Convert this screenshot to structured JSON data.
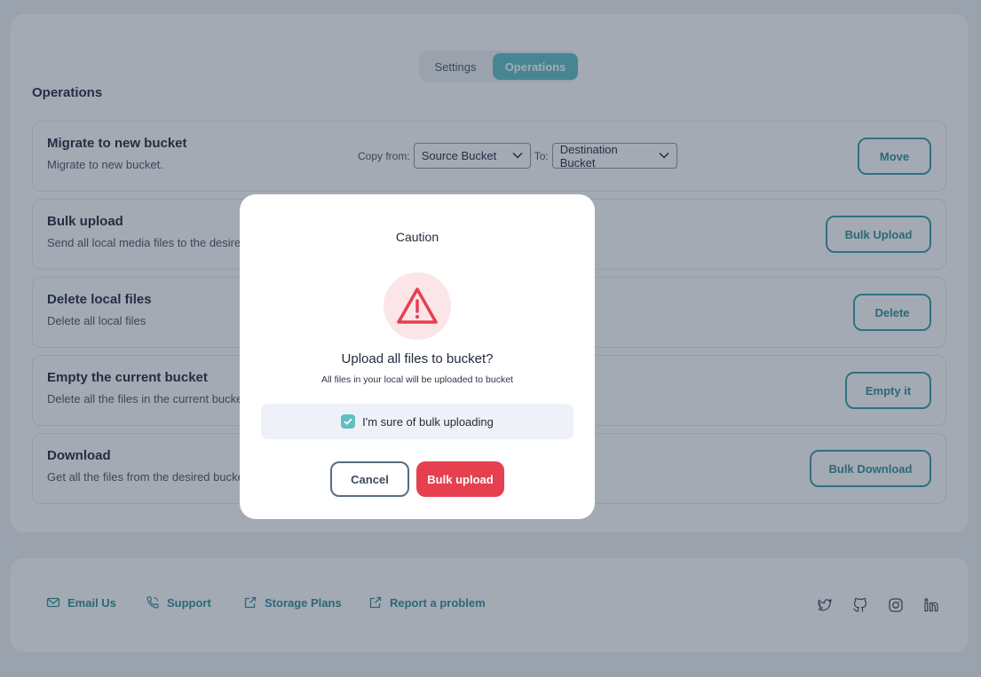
{
  "tabs": {
    "settings": "Settings",
    "operations": "Operations",
    "active": "operations"
  },
  "page_title": "Operations",
  "operations": [
    {
      "title": "Migrate to new bucket",
      "desc": "Migrate to new bucket.",
      "copy_from_label": "Copy from:",
      "source_select": "Source Bucket",
      "to_label": "To:",
      "destination_select": "Destination Bucket",
      "button": "Move"
    },
    {
      "title": "Bulk upload",
      "desc": "Send all local media files to the desired bucket",
      "button": "Bulk Upload"
    },
    {
      "title": "Delete local files",
      "desc": "Delete all local files",
      "button": "Delete"
    },
    {
      "title": "Empty the current bucket",
      "desc": "Delete all the files in the current bucket",
      "button": "Empty it"
    },
    {
      "title": "Download",
      "desc": "Get all the files from the desired bucket",
      "button": "Bulk Download"
    }
  ],
  "footer": {
    "links": [
      {
        "label": "Email Us",
        "icon": "mail-icon"
      },
      {
        "label": "Support",
        "icon": "phone-icon"
      },
      {
        "label": "Storage Plans",
        "icon": "external-link-icon"
      },
      {
        "label": "Report a problem",
        "icon": "external-link-icon"
      }
    ],
    "social": [
      "twitter-icon",
      "github-icon",
      "instagram-icon",
      "linkedin-icon"
    ]
  },
  "modal": {
    "title": "Caution",
    "icon": "warning-triangle-icon",
    "question": "Upload all files to bucket?",
    "subtext": "All files in your local will be uploaded to bucket",
    "confirm_label": "I'm sure of bulk uploading",
    "confirm_checked": true,
    "cancel_button": "Cancel",
    "confirm_button": "Bulk upload"
  },
  "colors": {
    "accent": "#5fbfc4",
    "accent_dark": "#2e8f96",
    "danger": "#e6404f",
    "overlay": "rgba(38,52,76,0.42)"
  }
}
